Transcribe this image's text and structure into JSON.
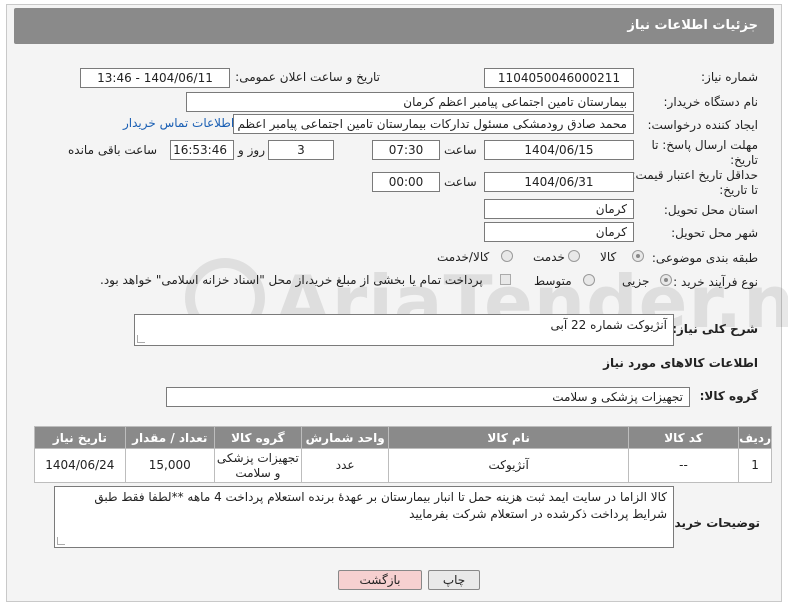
{
  "header": {
    "title": "جزئیات اطلاعات نیاز"
  },
  "form": {
    "need_number_label": "شماره نیاز:",
    "need_number": "1104050046000211",
    "announce_label": "تاریخ و ساعت اعلان عمومی:",
    "announce_value": "1404/06/11 - 13:46",
    "buyer_org_label": "نام دستگاه خریدار:",
    "buyer_org": "بیمارستان تامین اجتماعی پیامبر اعظم کرمان",
    "requester_label": "ایجاد کننده درخواست:",
    "requester": "محمد صادق  رودمشکی مسئول تدارکات بیمارستان تامین اجتماعی پیامبر اعظم",
    "buyer_contact_link": "اطلاعات تماس خریدار",
    "deadline_label": "مهلت ارسال پاسخ: تا تاریخ:",
    "deadline_date": "1404/06/15",
    "time_label": "ساعت",
    "deadline_time": "07:30",
    "days": "3",
    "days_label": "روز و",
    "remaining_time": "16:53:46",
    "remaining_label": "ساعت باقی مانده",
    "price_validity_label": "حداقل تاریخ اعتبار قیمت: تا تاریخ:",
    "price_validity_date": "1404/06/31",
    "price_validity_time": "00:00",
    "province_label": "استان محل تحویل:",
    "province": "کرمان",
    "city_label": "شهر محل تحویل:",
    "city": "کرمان",
    "category_label": "طبقه بندی موضوعی:",
    "category_options": [
      "کالا",
      "خدمت",
      "کالا/خدمت"
    ],
    "process_label": "نوع فرآیند خرید :",
    "process_options": [
      "جزیی",
      "متوسط"
    ],
    "payment_note": "پرداخت تمام یا بخشی از مبلغ خرید،از محل \"اسناد خزانه اسلامی\" خواهد بود."
  },
  "description": {
    "label": "شرح کلی نیاز:",
    "value": "آنژیوکت شماره 22 آبی"
  },
  "goods_info_title": "اطلاعات کالاهای مورد نیاز",
  "goods_group": {
    "label": "گروه کالا:",
    "value": "تجهیزات پزشکی و سلامت"
  },
  "table": {
    "headers": [
      "ردیف",
      "کد کالا",
      "نام کالا",
      "واحد شمارش",
      "گروه کالا",
      "تعداد / مقدار",
      "تاریخ نیاز"
    ],
    "rows": [
      [
        "1",
        "--",
        "آنژیوکت",
        "عدد",
        "تجهیزات پزشکی و سلامت",
        "15,000",
        "1404/06/24"
      ]
    ]
  },
  "buyer_notes": {
    "label": "توضیحات خریدار:",
    "value": "کالا الزاما در سایت ایمد ثبت هزینه حمل تا انبار بیمارستان بر عهدۀ برنده استعلام پرداخت 4 ماهه **لطفا فقط طبق شرایط پرداخت ذکرشده در استعلام شرکت بفرمایید"
  },
  "buttons": {
    "print": "چاپ",
    "back": "بازگشت"
  },
  "watermark": "AriaTender.neT",
  "colors": {
    "header_bg": "#8a8a8a",
    "link": "#1a5fb4",
    "back_button": "#f6d0d0"
  }
}
